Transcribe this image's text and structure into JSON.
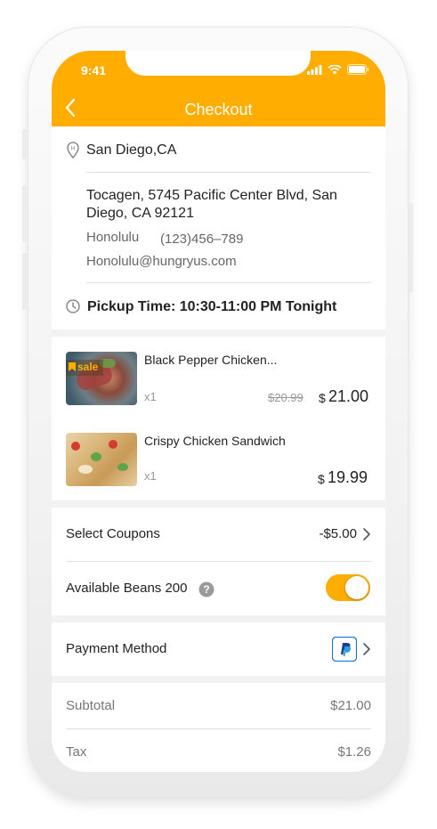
{
  "status_bar": {
    "time": "9:41"
  },
  "header": {
    "title": "Checkout"
  },
  "location": {
    "city": "San Diego,CA",
    "address": "Tocagen, 5745 Pacific Center Blvd, San Diego, CA 92121",
    "contact_name": "Honolulu",
    "phone": "(123)456–789",
    "email": "Honolulu@hungryus.com",
    "pickup_time": "Pickup Time: 10:30-11:00 PM Tonight"
  },
  "items": [
    {
      "name": "Black Pepper Chicken...",
      "badge": "sale",
      "qty": "x1",
      "original_price": "$20.99",
      "currency": "$",
      "price": "21.00"
    },
    {
      "name": "Crispy Chicken Sandwich",
      "badge": "",
      "qty": "x1",
      "original_price": "",
      "currency": "$",
      "price": "19.99"
    }
  ],
  "coupons": {
    "label": "Select Coupons",
    "value": "-$5.00"
  },
  "beans": {
    "label": "Available Beans 200",
    "toggle_on": true,
    "help_icon": "question-icon"
  },
  "payment": {
    "label": "Payment Method",
    "icon": "paypal-icon"
  },
  "summary": [
    {
      "label": "Subtotal",
      "value": "$21.00"
    },
    {
      "label": "Tax",
      "value": "$1.26"
    }
  ],
  "colors": {
    "accent": "#FFAD00",
    "text": "#222222",
    "muted": "#999999"
  }
}
